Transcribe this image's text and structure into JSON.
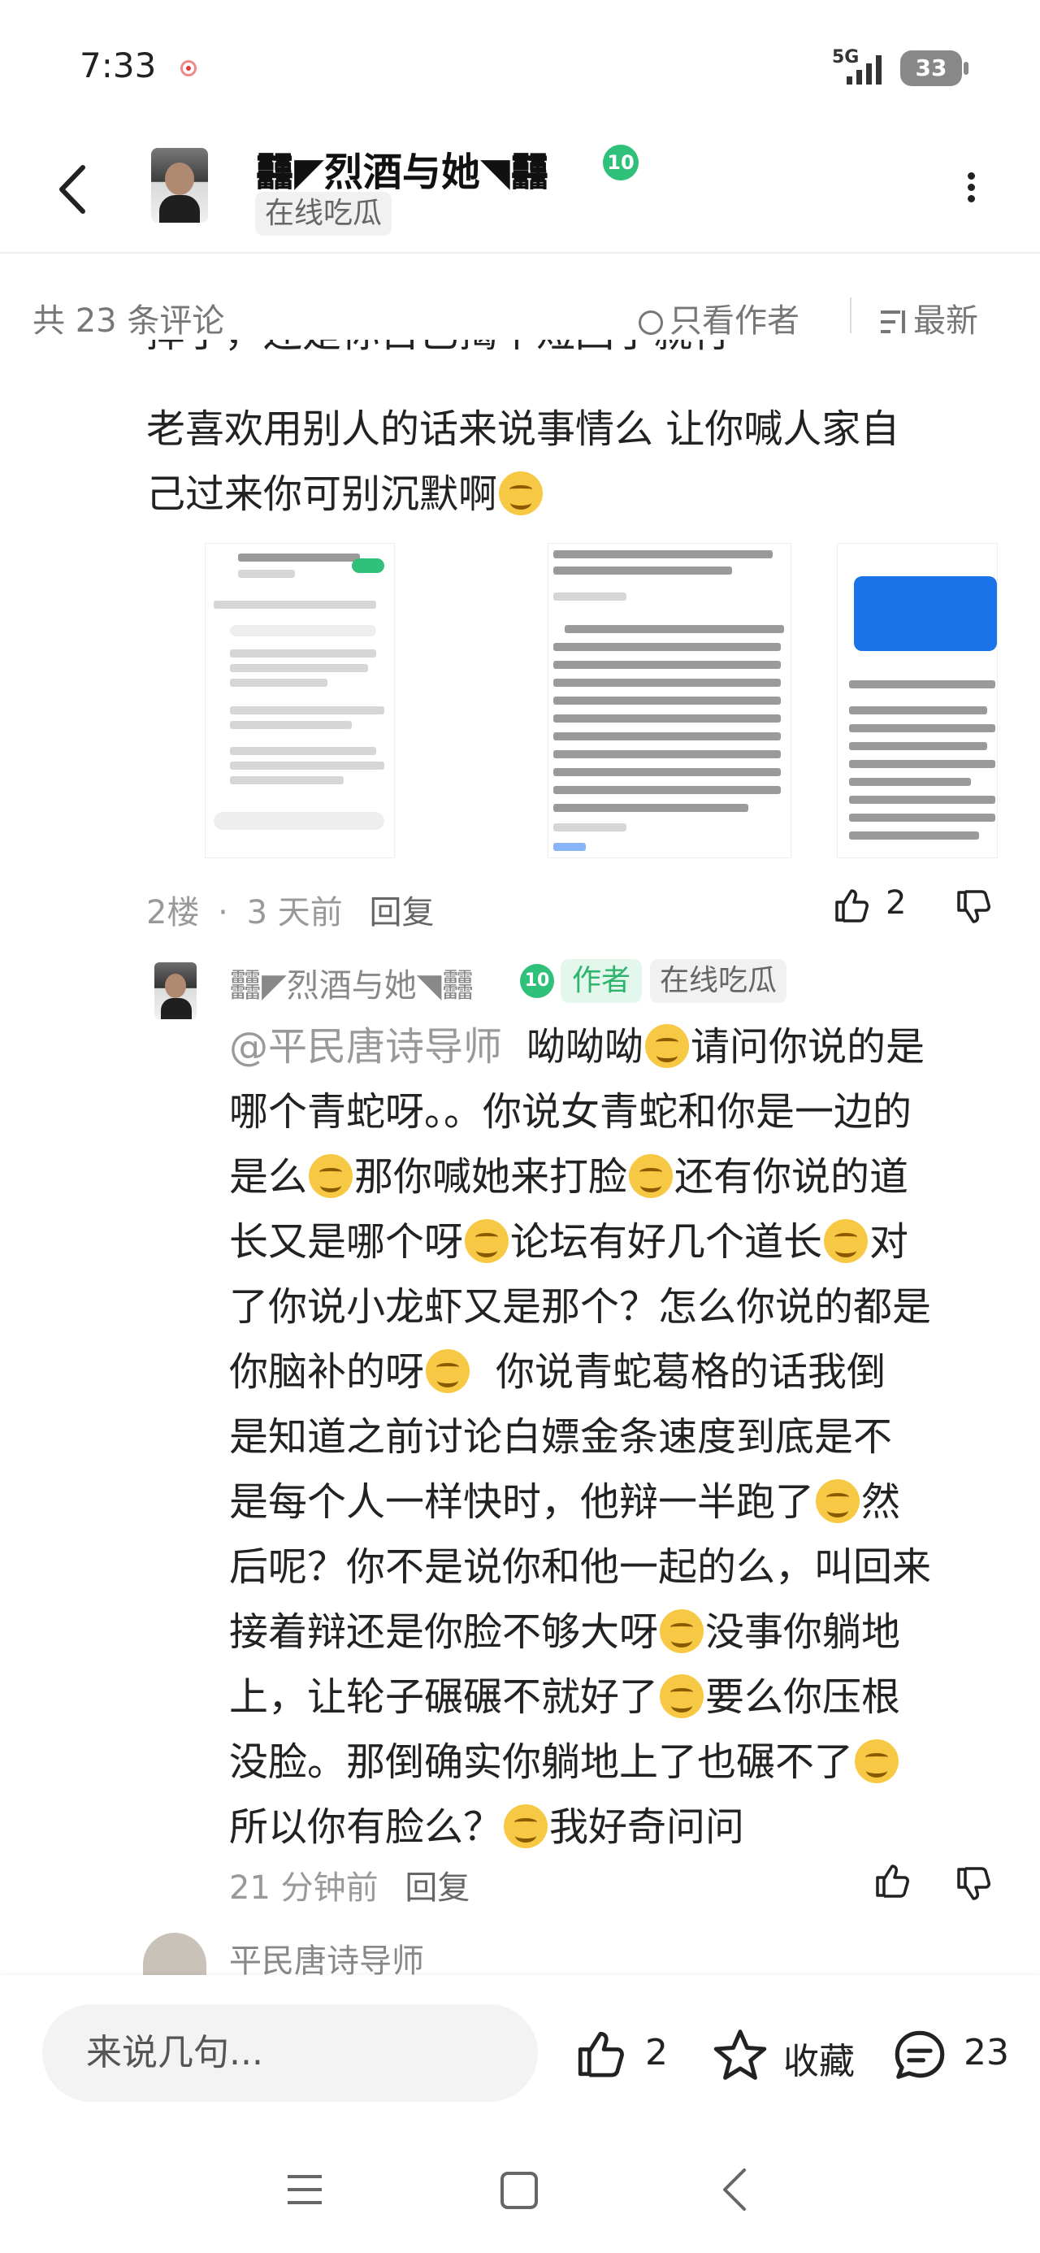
{
  "status_bar": {
    "time": "7:33",
    "network": "5G",
    "battery": "33"
  },
  "header": {
    "author_name": "䨻◤烈酒与她◥䨻",
    "level": "10",
    "status_tag": "在线吃瓜"
  },
  "comment_bar": {
    "count_text": "共 23 条评论",
    "author_only_label": "只看作者",
    "sort_label": "最新"
  },
  "post": {
    "partial_line": "摔了，还是你自己揭个短回了就行",
    "text_line2": "老喜欢用别人的话来说事情么  让你喊人家自",
    "text_line3": "己过来你可别沉默啊",
    "floor": "2楼",
    "dot": "·",
    "time": "3 天前",
    "reply_label": "回复",
    "like_count": "2"
  },
  "reply": {
    "author_name": "䨻◤烈酒与她◥䨻",
    "level": "10",
    "author_tag": "作者",
    "status_tag": "在线吃瓜",
    "mention": "@平民唐诗导师",
    "lines": [
      "呦呦呦",
      "请问你说的是",
      "哪个青蛇呀。。你说女青蛇和你是一边的",
      "是么",
      "那你喊她来打脸",
      "还有你说的道",
      "长又是哪个呀",
      "论坛有好几个道长",
      "对",
      "了你说小龙虾又是那个？怎么你说的都是",
      "你脑补的呀",
      "你说青蛇葛格的话我倒",
      "是知道之前讨论白嫖金条速度到底是不",
      "是每个人一样快时，他辩一半跑了",
      "然",
      "后呢？你不是说你和他一起的么，叫回来",
      "接着辩还是你脸不够大呀",
      "没事你躺地",
      "上，让轮子碾碾不就好了",
      "要么你压根",
      "没脸。那倒确实你躺地上了也碾不了",
      "所以你有脸么？",
      "我好奇问问"
    ],
    "time": "21 分钟前",
    "reply_label": "回复"
  },
  "next_comment": {
    "author_name": "平民唐诗导师"
  },
  "bottom_bar": {
    "input_placeholder": "来说几句...",
    "like_count": "2",
    "favorite_label": "收藏",
    "comment_count": "23"
  },
  "icons": [
    "back-icon",
    "more-icon",
    "like-icon",
    "dislike-icon",
    "star-icon",
    "comment-icon",
    "menu-icon",
    "home-icon",
    "nav-back-icon"
  ],
  "colors": {
    "level_green": "#2fc07a",
    "author_tag_green": "#2fb46e",
    "screenshot_blue": "#1a73e8"
  }
}
